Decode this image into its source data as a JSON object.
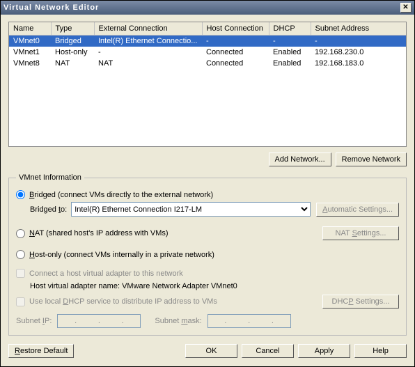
{
  "window": {
    "title": "Virtual Network Editor"
  },
  "table": {
    "headers": {
      "name": "Name",
      "type": "Type",
      "ext": "External Connection",
      "host": "Host Connection",
      "dhcp": "DHCP",
      "subnet": "Subnet Address"
    },
    "rows": [
      {
        "name": "VMnet0",
        "type": "Bridged",
        "ext": "Intel(R) Ethernet Connectio...",
        "host": "-",
        "dhcp": "-",
        "subnet": "-",
        "selected": true
      },
      {
        "name": "VMnet1",
        "type": "Host-only",
        "ext": "-",
        "host": "Connected",
        "dhcp": "Enabled",
        "subnet": "192.168.230.0"
      },
      {
        "name": "VMnet8",
        "type": "NAT",
        "ext": "NAT",
        "host": "Connected",
        "dhcp": "Enabled",
        "subnet": "192.168.183.0"
      }
    ]
  },
  "buttons": {
    "add_network": "Add Network...",
    "remove_network": "Remove Network",
    "automatic_settings": "Automatic Settings...",
    "nat_settings": "NAT Settings...",
    "dhcp_settings": "DHCP Settings...",
    "restore_default": "Restore Default",
    "ok": "OK",
    "cancel": "Cancel",
    "apply": "Apply",
    "help": "Help"
  },
  "group": {
    "legend": "VMnet Information",
    "bridged_label": "Bridged (connect VMs directly to the external network)",
    "bridged_to": "Bridged to:",
    "bridged_adapter": "Intel(R) Ethernet Connection I217-LM",
    "nat_label": "NAT (shared host's IP address with VMs)",
    "hostonly_label": "Host-only (connect VMs internally in a private network)",
    "connect_host": "Connect a host virtual adapter to this network",
    "host_adapter_name_label": "Host virtual adapter name: VMware Network Adapter VMnet0",
    "use_dhcp": "Use local DHCP service to distribute IP address to VMs",
    "subnet_ip": "Subnet IP:",
    "subnet_mask": "Subnet mask:"
  }
}
